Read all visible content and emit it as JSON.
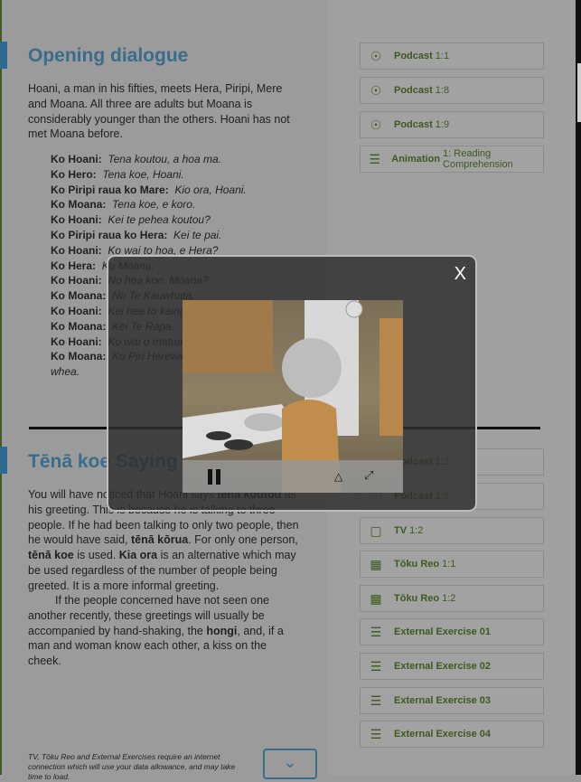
{
  "section1": {
    "title": "Opening dialogue",
    "intro": "Hoani, a man in his fifties, meets Hera, Piripi, Mere and Moana. All three are adults but Moana is considerably younger than the others. Hoani has not met Moana before.",
    "dialogue": [
      {
        "speaker": "Ko Hoani:",
        "line": "Tena koutou, a hoa ma."
      },
      {
        "speaker": "Ko Hero:",
        "line": "Tena koe, Hoani."
      },
      {
        "speaker": "Ko Piripi raua ko Mare:",
        "line": "Kio ora, Hoani."
      },
      {
        "speaker": "Ko Moana:",
        "line": "Tena koe, e koro."
      },
      {
        "speaker": "Ko Hoani:",
        "line": "Kei te pehea koutou?"
      },
      {
        "speaker": "Ko Piripi raua ko Hera:",
        "line": "Kei te pai."
      },
      {
        "speaker": "Ko Hoani:",
        "line": "Ko wai to hoa, e Hera?"
      },
      {
        "speaker": "Ko Hera:",
        "line": "Ko Moana."
      },
      {
        "speaker": "Ko Hoani:",
        "line": "No hea koe, Moana?"
      },
      {
        "speaker": "Ko Moana:",
        "line": "No Te Kauwhata."
      },
      {
        "speaker": "Ko Hoani:",
        "line": "Kei hea to kainga"
      },
      {
        "speaker": "Ko Moana:",
        "line": "Kei Te Rapa."
      },
      {
        "speaker": "Ko Hoani:",
        "line": "Ko wai o matua, e"
      },
      {
        "speaker": "Ko Moana:",
        "line": "Ko Piri Herewini"
      }
    ],
    "dialogue_tail": "whea."
  },
  "section2": {
    "title": "Tēnā koe Saying ‘h",
    "p1": [
      "You will have noticed that Hoani says ",
      "tena koutou",
      " as his greeting. This is because he is talking to three people. If he had been talking to only two people, then he would have said, ",
      "tēnā kōrua",
      ". For only one person, ",
      "tēnā koe",
      " is used. ",
      "Kia ora",
      " is an alternative which may be used regardless of the number of people being greeted. It is a more informal greeting."
    ],
    "p2": [
      "If the people concerned have not seen one another recently, these greetings will usually be accompanied by hand-shaking, the ",
      "hongi",
      ", and, if a man and woman know each other, a kiss on the cheek."
    ]
  },
  "resources1": [
    {
      "icon": "podcast-icon",
      "bold": "Podcast",
      "rest": "1:1"
    },
    {
      "icon": "podcast-icon",
      "bold": "Podcast",
      "rest": "1:8"
    },
    {
      "icon": "podcast-icon",
      "bold": "Podcast",
      "rest": "1:9"
    },
    {
      "icon": "list-icon",
      "bold": "Animation",
      "rest": "1: Reading Comprehension"
    }
  ],
  "resources2": [
    {
      "icon": "podcast-icon",
      "bold": "Podcast",
      "rest": "1:2"
    },
    {
      "icon": "podcast-icon",
      "bold": "Podcast",
      "rest": "1:5"
    },
    {
      "icon": "tv-icon",
      "bold": "TV",
      "rest": "1:2"
    },
    {
      "icon": "toku-reo-icon",
      "bold": "Tōku Reo",
      "rest": "1:1"
    },
    {
      "icon": "toku-reo-icon",
      "bold": "Tōku Reo",
      "rest": "1:2"
    },
    {
      "icon": "list-icon",
      "bold": "External Exercise 01",
      "rest": ""
    },
    {
      "icon": "list-icon",
      "bold": "External Exercise 02",
      "rest": ""
    },
    {
      "icon": "list-icon",
      "bold": "External Exercise 03",
      "rest": ""
    },
    {
      "icon": "list-icon",
      "bold": "External Exercise 04",
      "rest": ""
    }
  ],
  "footer_note": "TV, Tōku Reo and External Exercises require an internet connection which will use your data allowance, and may take time to load.",
  "modal": {
    "close_label": "X",
    "playing": true
  },
  "colors": {
    "accent": "#3a6c8b",
    "resource_text": "#3c5a1e"
  }
}
